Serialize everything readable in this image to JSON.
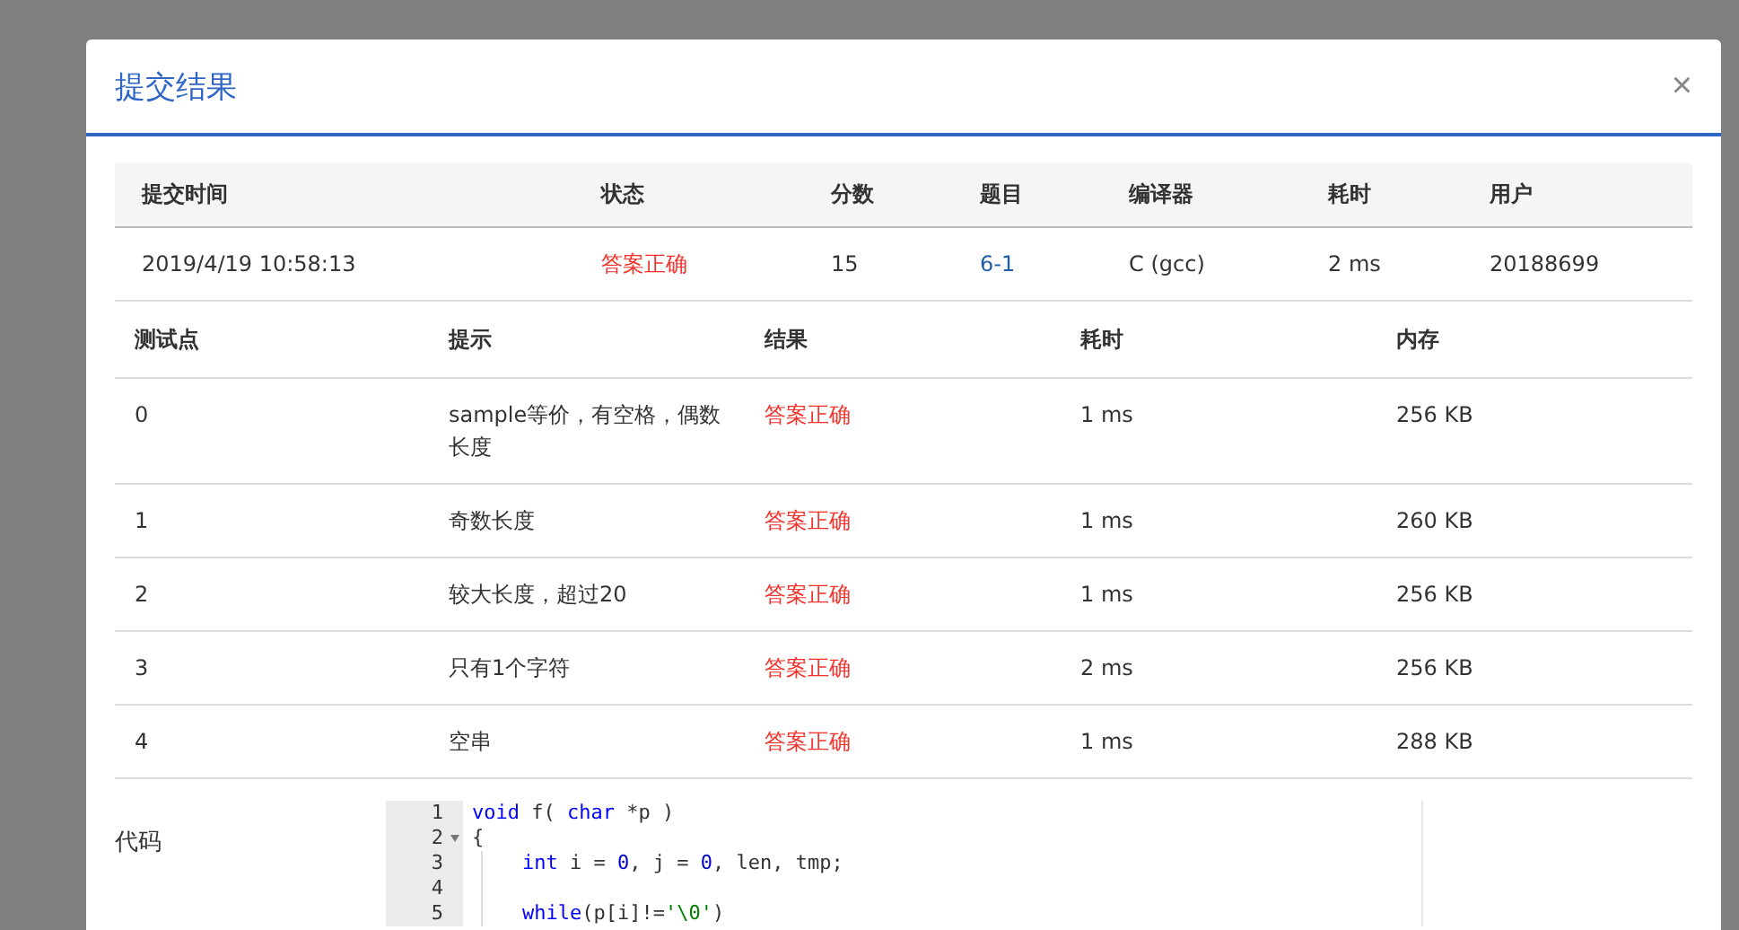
{
  "dialog": {
    "title": "提交结果",
    "close": "×"
  },
  "summary": {
    "columns": [
      "提交时间",
      "状态",
      "分数",
      "题目",
      "编译器",
      "耗时",
      "用户"
    ],
    "row": {
      "time": "2019/4/19 10:58:13",
      "status": "答案正确",
      "score": "15",
      "problem": "6-1",
      "compiler": "C (gcc)",
      "duration": "2 ms",
      "user": "20188699"
    }
  },
  "tests": {
    "columns": [
      "测试点",
      "提示",
      "结果",
      "耗时",
      "内存"
    ],
    "rows": [
      {
        "id": "0",
        "hint": "sample等价，有空格，偶数长度",
        "result": "答案正确",
        "duration": "1 ms",
        "memory": "256 KB"
      },
      {
        "id": "1",
        "hint": "奇数长度",
        "result": "答案正确",
        "duration": "1 ms",
        "memory": "260 KB"
      },
      {
        "id": "2",
        "hint": "较大长度，超过20",
        "result": "答案正确",
        "duration": "1 ms",
        "memory": "256 KB"
      },
      {
        "id": "3",
        "hint": "只有1个字符",
        "result": "答案正确",
        "duration": "2 ms",
        "memory": "256 KB"
      },
      {
        "id": "4",
        "hint": "空串",
        "result": "答案正确",
        "duration": "1 ms",
        "memory": "288 KB"
      }
    ]
  },
  "code": {
    "label": "代码",
    "lines": [
      {
        "number": "1",
        "foldable": false,
        "indented": false,
        "tokens": [
          {
            "kind": "keyword",
            "text": "void"
          },
          {
            "kind": "plain",
            "text": " f( "
          },
          {
            "kind": "keyword",
            "text": "char"
          },
          {
            "kind": "plain",
            "text": " *p )"
          }
        ]
      },
      {
        "number": "2",
        "foldable": true,
        "indented": false,
        "tokens": [
          {
            "kind": "plain",
            "text": "{"
          }
        ]
      },
      {
        "number": "3",
        "foldable": false,
        "indented": true,
        "tokens": [
          {
            "kind": "keyword",
            "text": "int"
          },
          {
            "kind": "plain",
            "text": " i = "
          },
          {
            "kind": "number",
            "text": "0"
          },
          {
            "kind": "plain",
            "text": ", j = "
          },
          {
            "kind": "number",
            "text": "0"
          },
          {
            "kind": "plain",
            "text": ", len, tmp;"
          }
        ]
      },
      {
        "number": "4",
        "foldable": false,
        "indented": true
      },
      {
        "number": "5",
        "foldable": false,
        "indented": true,
        "tokens": [
          {
            "kind": "keyword",
            "text": "while"
          },
          {
            "kind": "plain",
            "text": "(p[i]!="
          },
          {
            "kind": "string",
            "text": "'\\0'"
          },
          {
            "kind": "plain",
            "text": ")"
          }
        ]
      }
    ]
  }
}
